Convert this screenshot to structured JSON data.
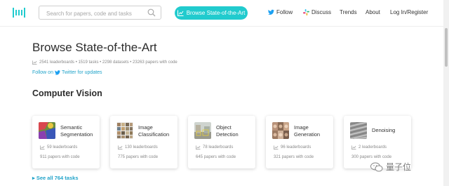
{
  "header": {
    "search_placeholder": "Search for papers, code and tasks",
    "browse_button": "Browse State-of-the-Art",
    "nav": {
      "follow": "Follow",
      "discuss": "Discuss",
      "trends": "Trends",
      "about": "About",
      "login": "Log In/Register"
    }
  },
  "main": {
    "title": "Browse State-of-the-Art",
    "stats": "2541 leaderboards • 1519 tasks • 2298 datasets • 23263 papers with code",
    "follow_prefix": "Follow on",
    "follow_link": "Twitter for updates",
    "section_title": "Computer Vision",
    "see_all": "See all 764 tasks"
  },
  "cards": [
    {
      "title": "Semantic Segmentation",
      "leaderboards": "59 leaderboards",
      "papers": "911 papers with code",
      "thumb": "segmentation-image"
    },
    {
      "title": "Image Classification",
      "leaderboards": "130 leaderboards",
      "papers": "775 papers with code",
      "thumb": "image-grid"
    },
    {
      "title": "Object Detection",
      "leaderboards": "78 leaderboards",
      "papers": "645 papers with code",
      "thumb": "street-scene"
    },
    {
      "title": "Image Generation",
      "leaderboards": "96 leaderboards",
      "papers": "321 papers with code",
      "thumb": "faces-grid"
    },
    {
      "title": "Denoising",
      "leaderboards": "2 leaderboards",
      "papers": "300 papers with code",
      "thumb": "noisy-texture"
    }
  ],
  "watermark": "量子位",
  "colors": {
    "accent": "#21cbce",
    "link": "#21a3c9"
  }
}
